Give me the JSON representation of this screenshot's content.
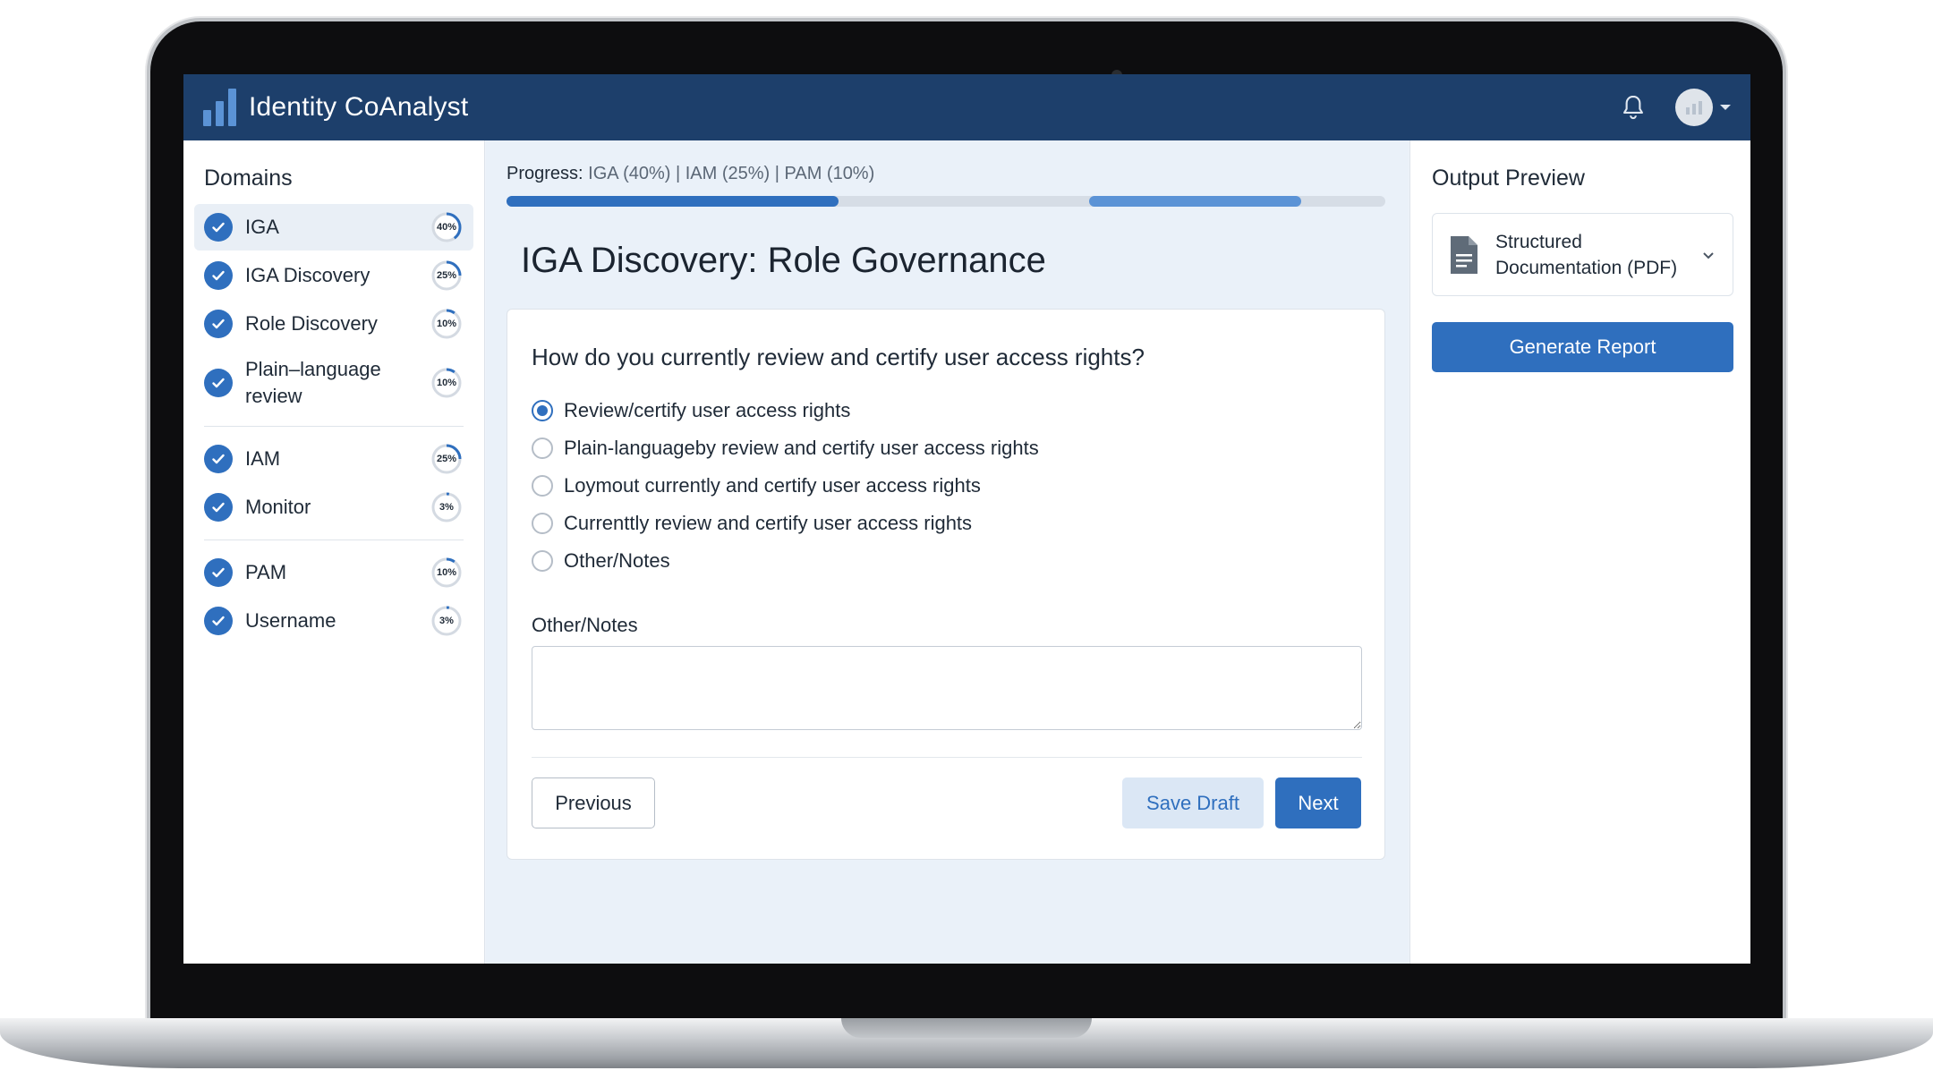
{
  "app": {
    "title": "Identity CoAnalyst"
  },
  "colors": {
    "header": "#1d3f6b",
    "accent": "#2f6fbe",
    "accent_light": "#5b93d6"
  },
  "sidebar": {
    "heading": "Domains",
    "groups": [
      [
        {
          "label": "IGA",
          "percent_text": "40%",
          "percent": 40,
          "active": true
        },
        {
          "label": "IGA Discovery",
          "percent_text": "25%",
          "percent": 25
        },
        {
          "label": "Role Discovery",
          "percent_text": "10%",
          "percent": 10
        },
        {
          "label": "Plain–language review",
          "percent_text": "10%",
          "percent": 10
        }
      ],
      [
        {
          "label": "IAM",
          "percent_text": "25%",
          "percent": 25
        },
        {
          "label": "Monitor",
          "percent_text": "3%",
          "percent": 3
        }
      ],
      [
        {
          "label": "PAM",
          "percent_text": "10%",
          "percent": 10
        },
        {
          "label": "Username",
          "percent_text": "3%",
          "percent": 3
        }
      ]
    ]
  },
  "progress": {
    "label": "Progress:",
    "values_text": "IGA (40%) | IAM (25%) | PAM (10%)"
  },
  "main": {
    "title": "IGA Discovery: Role Governance",
    "question": "How do you currently review and certify user access rights?",
    "options": [
      {
        "label": "Review/certify user access rights",
        "selected": true
      },
      {
        "label": "Plain-languageby review and certify user access rights",
        "selected": false
      },
      {
        "label": "Loymout currently and certify user access rights",
        "selected": false
      },
      {
        "label": "Currenttly review and certify user access rights",
        "selected": false
      },
      {
        "label": "Other/Notes",
        "selected": false
      }
    ],
    "notes_label": "Other/Notes",
    "notes_value": "",
    "buttons": {
      "previous": "Previous",
      "save_draft": "Save Draft",
      "next": "Next"
    }
  },
  "output": {
    "heading": "Output Preview",
    "format_line1": "Structured",
    "format_line2": "Documentation (PDF)",
    "generate_label": "Generate Report"
  }
}
